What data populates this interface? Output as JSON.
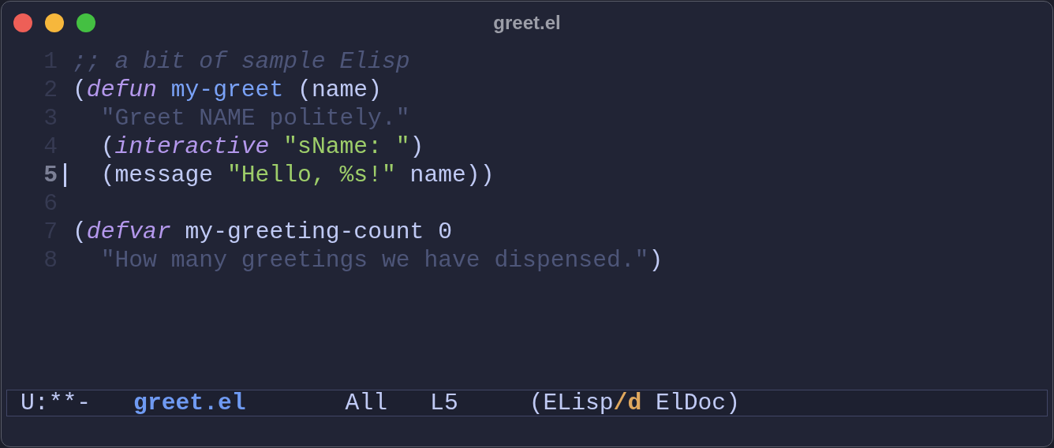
{
  "window": {
    "title": "greet.el"
  },
  "editor": {
    "lines": [
      {
        "number": "1",
        "current": false,
        "tokens": [
          {
            "kind": "comment",
            "text": ";; a bit of sample Elisp"
          }
        ]
      },
      {
        "number": "2",
        "current": false,
        "tokens": [
          {
            "kind": "plain",
            "text": "("
          },
          {
            "kind": "keyword",
            "text": "defun"
          },
          {
            "kind": "function",
            "text": " my-greet"
          },
          {
            "kind": "plain",
            "text": " (name)"
          }
        ]
      },
      {
        "number": "3",
        "current": false,
        "tokens": [
          {
            "kind": "doc",
            "text": "  \"Greet NAME politely.\""
          }
        ]
      },
      {
        "number": "4",
        "current": false,
        "tokens": [
          {
            "kind": "plain",
            "text": "  ("
          },
          {
            "kind": "keyword",
            "text": "interactive"
          },
          {
            "kind": "string",
            "text": " \"sName: \""
          },
          {
            "kind": "plain",
            "text": ")"
          }
        ]
      },
      {
        "number": "5",
        "current": true,
        "tokens": [
          {
            "kind": "plain",
            "text": "  (message "
          },
          {
            "kind": "string",
            "text": "\"Hello, %s!\""
          },
          {
            "kind": "plain",
            "text": " name))"
          }
        ]
      },
      {
        "number": "6",
        "current": false
      },
      {
        "number": "7",
        "current": false,
        "tokens": [
          {
            "kind": "plain",
            "text": "("
          },
          {
            "kind": "keyword",
            "text": "defvar"
          },
          {
            "kind": "plain",
            "text": " my-greeting-count 0"
          }
        ]
      },
      {
        "number": "8",
        "current": false,
        "tokens": [
          {
            "kind": "doc",
            "text": "  \"How many greetings we have dispensed.\""
          },
          {
            "kind": "plain",
            "text": ")"
          }
        ]
      }
    ]
  },
  "mode_line": {
    "segments": [
      {
        "kind": "status",
        "tokens": [
          {
            "kind": "plain",
            "text": "U:**-"
          }
        ]
      },
      {
        "kind": "buffer",
        "tokens": [
          {
            "kind": "buffer",
            "text": "greet.el"
          }
        ]
      },
      {
        "kind": "position",
        "tokens": [
          {
            "kind": "plain",
            "text": "All"
          }
        ]
      },
      {
        "kind": "line",
        "tokens": [
          {
            "kind": "plain",
            "text": "L5"
          }
        ]
      },
      {
        "kind": "modes",
        "tokens": [
          {
            "kind": "plain",
            "text": "(ELisp"
          },
          {
            "kind": "flag",
            "text": "/d"
          },
          {
            "kind": "plain",
            "text": " ElDoc)"
          }
        ]
      }
    ]
  }
}
